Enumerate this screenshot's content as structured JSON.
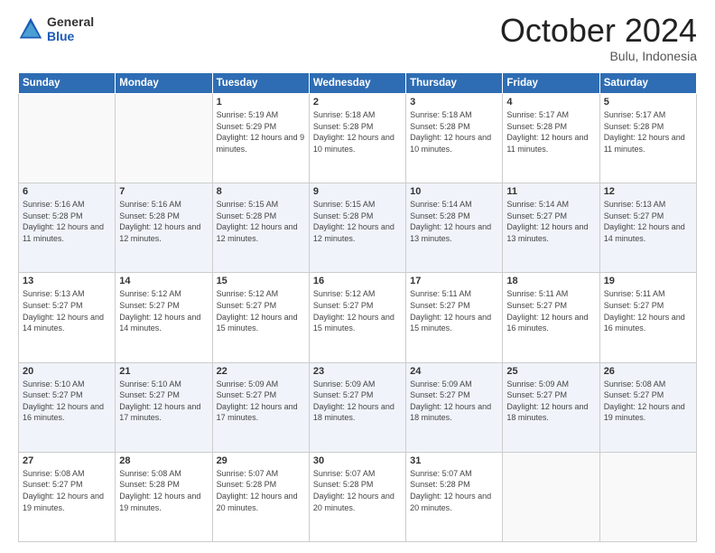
{
  "header": {
    "logo_general": "General",
    "logo_blue": "Blue",
    "month_title": "October 2024",
    "location": "Bulu, Indonesia"
  },
  "days_of_week": [
    "Sunday",
    "Monday",
    "Tuesday",
    "Wednesday",
    "Thursday",
    "Friday",
    "Saturday"
  ],
  "weeks": [
    [
      {
        "day": "",
        "info": ""
      },
      {
        "day": "",
        "info": ""
      },
      {
        "day": "1",
        "info": "Sunrise: 5:19 AM\nSunset: 5:29 PM\nDaylight: 12 hours and 9 minutes."
      },
      {
        "day": "2",
        "info": "Sunrise: 5:18 AM\nSunset: 5:28 PM\nDaylight: 12 hours and 10 minutes."
      },
      {
        "day": "3",
        "info": "Sunrise: 5:18 AM\nSunset: 5:28 PM\nDaylight: 12 hours and 10 minutes."
      },
      {
        "day": "4",
        "info": "Sunrise: 5:17 AM\nSunset: 5:28 PM\nDaylight: 12 hours and 11 minutes."
      },
      {
        "day": "5",
        "info": "Sunrise: 5:17 AM\nSunset: 5:28 PM\nDaylight: 12 hours and 11 minutes."
      }
    ],
    [
      {
        "day": "6",
        "info": "Sunrise: 5:16 AM\nSunset: 5:28 PM\nDaylight: 12 hours and 11 minutes."
      },
      {
        "day": "7",
        "info": "Sunrise: 5:16 AM\nSunset: 5:28 PM\nDaylight: 12 hours and 12 minutes."
      },
      {
        "day": "8",
        "info": "Sunrise: 5:15 AM\nSunset: 5:28 PM\nDaylight: 12 hours and 12 minutes."
      },
      {
        "day": "9",
        "info": "Sunrise: 5:15 AM\nSunset: 5:28 PM\nDaylight: 12 hours and 12 minutes."
      },
      {
        "day": "10",
        "info": "Sunrise: 5:14 AM\nSunset: 5:28 PM\nDaylight: 12 hours and 13 minutes."
      },
      {
        "day": "11",
        "info": "Sunrise: 5:14 AM\nSunset: 5:27 PM\nDaylight: 12 hours and 13 minutes."
      },
      {
        "day": "12",
        "info": "Sunrise: 5:13 AM\nSunset: 5:27 PM\nDaylight: 12 hours and 14 minutes."
      }
    ],
    [
      {
        "day": "13",
        "info": "Sunrise: 5:13 AM\nSunset: 5:27 PM\nDaylight: 12 hours and 14 minutes."
      },
      {
        "day": "14",
        "info": "Sunrise: 5:12 AM\nSunset: 5:27 PM\nDaylight: 12 hours and 14 minutes."
      },
      {
        "day": "15",
        "info": "Sunrise: 5:12 AM\nSunset: 5:27 PM\nDaylight: 12 hours and 15 minutes."
      },
      {
        "day": "16",
        "info": "Sunrise: 5:12 AM\nSunset: 5:27 PM\nDaylight: 12 hours and 15 minutes."
      },
      {
        "day": "17",
        "info": "Sunrise: 5:11 AM\nSunset: 5:27 PM\nDaylight: 12 hours and 15 minutes."
      },
      {
        "day": "18",
        "info": "Sunrise: 5:11 AM\nSunset: 5:27 PM\nDaylight: 12 hours and 16 minutes."
      },
      {
        "day": "19",
        "info": "Sunrise: 5:11 AM\nSunset: 5:27 PM\nDaylight: 12 hours and 16 minutes."
      }
    ],
    [
      {
        "day": "20",
        "info": "Sunrise: 5:10 AM\nSunset: 5:27 PM\nDaylight: 12 hours and 16 minutes."
      },
      {
        "day": "21",
        "info": "Sunrise: 5:10 AM\nSunset: 5:27 PM\nDaylight: 12 hours and 17 minutes."
      },
      {
        "day": "22",
        "info": "Sunrise: 5:09 AM\nSunset: 5:27 PM\nDaylight: 12 hours and 17 minutes."
      },
      {
        "day": "23",
        "info": "Sunrise: 5:09 AM\nSunset: 5:27 PM\nDaylight: 12 hours and 18 minutes."
      },
      {
        "day": "24",
        "info": "Sunrise: 5:09 AM\nSunset: 5:27 PM\nDaylight: 12 hours and 18 minutes."
      },
      {
        "day": "25",
        "info": "Sunrise: 5:09 AM\nSunset: 5:27 PM\nDaylight: 12 hours and 18 minutes."
      },
      {
        "day": "26",
        "info": "Sunrise: 5:08 AM\nSunset: 5:27 PM\nDaylight: 12 hours and 19 minutes."
      }
    ],
    [
      {
        "day": "27",
        "info": "Sunrise: 5:08 AM\nSunset: 5:27 PM\nDaylight: 12 hours and 19 minutes."
      },
      {
        "day": "28",
        "info": "Sunrise: 5:08 AM\nSunset: 5:28 PM\nDaylight: 12 hours and 19 minutes."
      },
      {
        "day": "29",
        "info": "Sunrise: 5:07 AM\nSunset: 5:28 PM\nDaylight: 12 hours and 20 minutes."
      },
      {
        "day": "30",
        "info": "Sunrise: 5:07 AM\nSunset: 5:28 PM\nDaylight: 12 hours and 20 minutes."
      },
      {
        "day": "31",
        "info": "Sunrise: 5:07 AM\nSunset: 5:28 PM\nDaylight: 12 hours and 20 minutes."
      },
      {
        "day": "",
        "info": ""
      },
      {
        "day": "",
        "info": ""
      }
    ]
  ]
}
